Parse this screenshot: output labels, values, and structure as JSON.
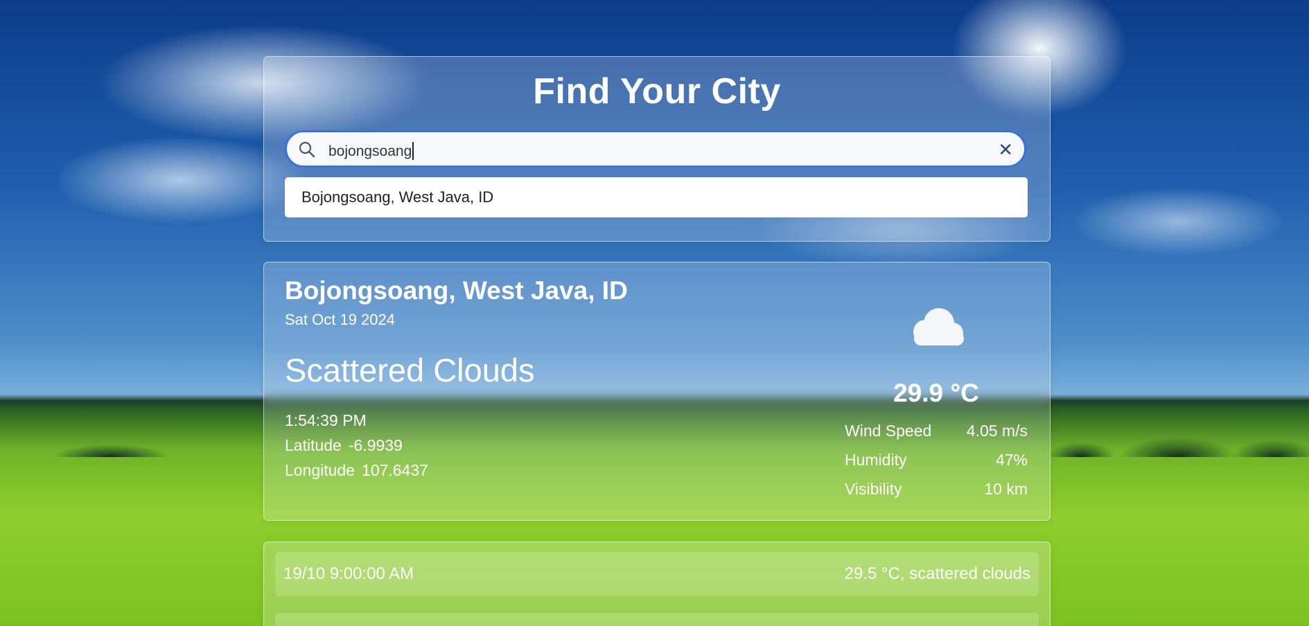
{
  "search": {
    "title": "Find Your City",
    "query": "bojongsoang",
    "suggestion": "Bojongsoang, West Java, ID"
  },
  "weather": {
    "city": "Bojongsoang, West Java, ID",
    "date": "Sat Oct 19 2024",
    "condition": "Scattered Clouds",
    "time": "1:54:39 PM",
    "latitude_label": "Latitude",
    "latitude": "-6.9939",
    "longitude_label": "Longitude",
    "longitude": "107.6437",
    "temperature": "29.9 °C",
    "icon": "cloud-icon",
    "stats": [
      {
        "label": "Wind Speed",
        "value": "4.05 m/s"
      },
      {
        "label": "Humidity",
        "value": "47%"
      },
      {
        "label": "Visibility",
        "value": "10 km"
      }
    ]
  },
  "forecast": [
    {
      "time": "19/10 9:00:00 AM",
      "summary": "29.5 °C, scattered clouds"
    },
    {
      "time": "",
      "summary": ""
    }
  ]
}
